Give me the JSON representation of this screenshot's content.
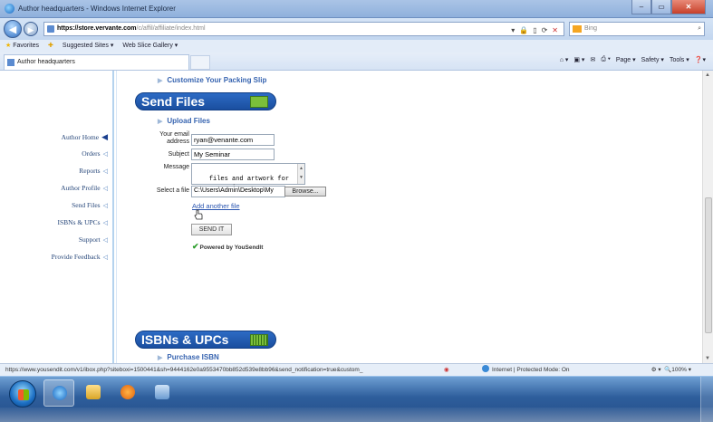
{
  "window": {
    "title": "Author headquarters - Windows Internet Explorer",
    "minimize": "–",
    "maximize": "▭",
    "close": "✕"
  },
  "address": {
    "url_host": "https://store.vervante.com",
    "url_rest": "/c/affil/affiliate/index.html",
    "search_placeholder": "Bing"
  },
  "favorites": {
    "label": "Favorites",
    "items": [
      "Suggested Sites ▾",
      "Web Slice Gallery ▾"
    ]
  },
  "tab": {
    "title": "Author headquarters"
  },
  "command_bar": [
    "Page ▾",
    "Safety ▾",
    "Tools ▾",
    "❓▾"
  ],
  "sidebar": {
    "items": [
      {
        "label": "Author Home",
        "active": true
      },
      {
        "label": "Orders"
      },
      {
        "label": "Reports"
      },
      {
        "label": "Author Profile"
      },
      {
        "label": "Send Files"
      },
      {
        "label": "ISBNs & UPCs"
      },
      {
        "label": "Support"
      },
      {
        "label": "Provide Feedback"
      }
    ]
  },
  "main": {
    "customize_link": "Customize Your Packing Slip",
    "send_files_header": "Send Files",
    "upload_link": "Upload Files",
    "form": {
      "email_label_1": "Your email",
      "email_label_2": "address",
      "email_value": "ryan@venante.com",
      "subject_label": "Subject",
      "subject_value": "My Seminar",
      "message_label": "Message",
      "message_value": "files and artwork for\nmy new seminar program.",
      "file_label": "Select a file",
      "file_value": "C:\\Users\\Admin\\Desktop\\My",
      "browse_label": "Browse...",
      "add_another": "Add another file",
      "send_button": "SEND IT",
      "powered_by": "Powered by YouSendIt"
    },
    "isbn_header": "ISBNs & UPCs",
    "purchase_link": "Purchase ISBN"
  },
  "status": {
    "url": "https://www.yousendit.com/v1/ibox.php?siteboxi=1500441&sh=9444162e0a9553470bb852d539e8bb96&send_notification=true&custom_",
    "zone": "Internet | Protected Mode: On",
    "zoom": "100%"
  }
}
